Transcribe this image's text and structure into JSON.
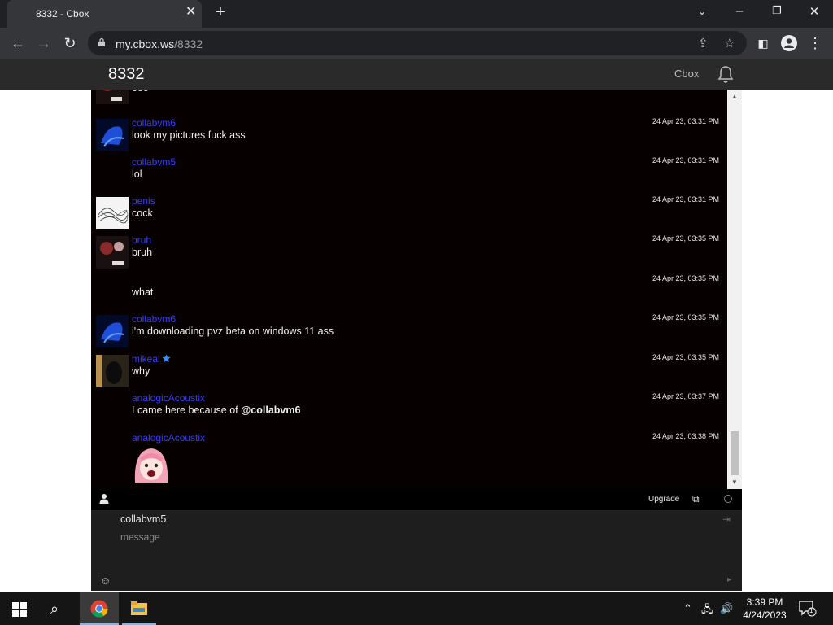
{
  "browser": {
    "tab_title": "8332 - Cbox",
    "url_host": "my.cbox.ws",
    "url_path": "/8332"
  },
  "app": {
    "title": "8332",
    "cbox_link": "Cbox"
  },
  "messages": [
    {
      "user": "",
      "text": "ooo",
      "time": "",
      "avatar": "bruh-avatar"
    },
    {
      "user": "collabvm6",
      "text": "look my pictures fuck ass",
      "time": "24 Apr 23, 03:31 PM",
      "avatar": "jellyfish-avatar"
    },
    {
      "user": "collabvm5",
      "text": "lol",
      "time": "24 Apr 23, 03:31 PM",
      "avatar": ""
    },
    {
      "user": "penis",
      "text": "cock",
      "time": "24 Apr 23, 03:31 PM",
      "avatar": "scribble-avatar"
    },
    {
      "user": "bruh",
      "text": "bruh",
      "time": "24 Apr 23, 03:35 PM",
      "avatar": "bruh-avatar"
    },
    {
      "user": "",
      "text": "what",
      "time": "24 Apr 23, 03:35 PM",
      "avatar": ""
    },
    {
      "user": "collabvm6",
      "text": "i'm downloading pvz beta on windows 11 ass",
      "time": "24 Apr 23, 03:35 PM",
      "avatar": "jellyfish-avatar"
    },
    {
      "user": "mikeal",
      "text": "why",
      "time": "24 Apr 23, 03:35 PM",
      "avatar": "dark-avatar"
    },
    {
      "user": "analogicAcoustix",
      "text_prefix": "I came here because of ",
      "mention": "@collabvm6",
      "time": "24 Apr 23, 03:37 PM",
      "avatar": ""
    },
    {
      "user": "analogicAcoustix",
      "text": "",
      "time": "24 Apr 23, 03:38 PM",
      "avatar": ""
    }
  ],
  "chatbar": {
    "upgrade_label": "Upgrade"
  },
  "form": {
    "name_value": "collabvm5",
    "message_placeholder": "message"
  },
  "taskbar": {
    "time": "3:39 PM",
    "date": "4/24/2023",
    "notification_count": "1"
  },
  "colors": {
    "chat_bg": "#070000",
    "username": "#3a3aff",
    "header_bg": "#2a2a2a"
  }
}
